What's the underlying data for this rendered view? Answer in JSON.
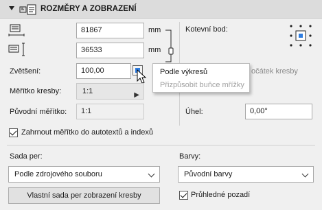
{
  "header": {
    "title": "ROZMĚRY A ZOBRAZENÍ"
  },
  "dimensions": {
    "width_value": "81867",
    "height_value": "36533",
    "unit": "mm"
  },
  "anchor": {
    "label": "Kotevní bod:"
  },
  "scale": {
    "label": "Zvětšení:",
    "value": "100,00"
  },
  "popup": {
    "item1": "Podle výkresů",
    "item2": "Přizpůsobit buňce mřížky"
  },
  "origin_partial": "očátek kresby",
  "drawing_scale": {
    "label": "Měřítko kresby:",
    "value": "1:1"
  },
  "original_scale": {
    "label": "Původní měřítko:",
    "value": "1:1"
  },
  "angle": {
    "label": "Úhel:",
    "value": "0,00°"
  },
  "autotext_checkbox": {
    "label": "Zahrnout měřítko do autotextů a indexů",
    "checked": true
  },
  "pen_set": {
    "label": "Sada per:",
    "value": "Podle zdrojového souboru"
  },
  "colors": {
    "label": "Barvy:",
    "value": "Původní barvy"
  },
  "custom_pen_button": {
    "label": "Vlastní sada per zobrazení kresby"
  },
  "transparent_checkbox": {
    "label": "Průhledné pozadí",
    "checked": true
  },
  "accent_color": "#2f7de0"
}
